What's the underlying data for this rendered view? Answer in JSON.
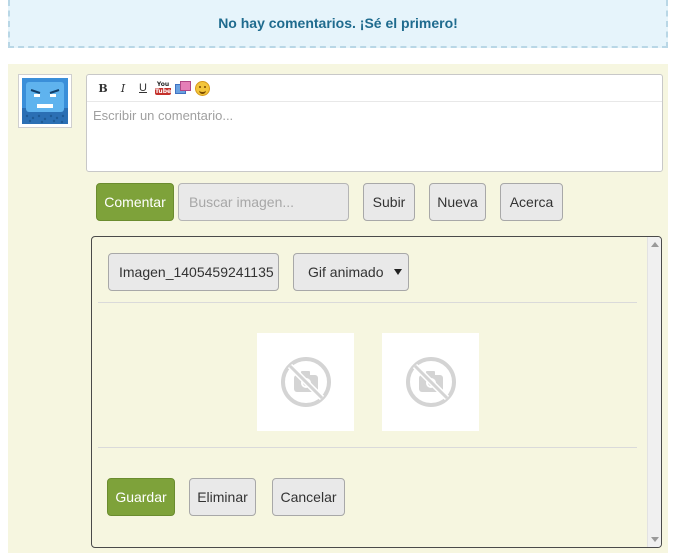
{
  "notice": {
    "text": "No hay comentarios. ¡Sé el primero!"
  },
  "editor": {
    "toolbar": [
      {
        "name": "bold-icon",
        "label": "B"
      },
      {
        "name": "italic-icon",
        "label": "I"
      },
      {
        "name": "underline-icon",
        "label": "U"
      },
      {
        "name": "youtube-icon"
      },
      {
        "name": "image-icon"
      },
      {
        "name": "emoji-icon"
      }
    ],
    "placeholder": "Escribir un comentario..."
  },
  "actions": {
    "comment_label": "Comentar",
    "search_placeholder": "Buscar imagen...",
    "upload_label": "Subir",
    "new_label": "Nueva",
    "about_label": "Acerca"
  },
  "image_panel": {
    "filename": "Imagen_1405459241135",
    "format_selected": "Gif animado",
    "thumbnails": [
      "broken-image-icon",
      "broken-image-icon"
    ],
    "save_label": "Guardar",
    "delete_label": "Eliminar",
    "cancel_label": "Cancelar"
  },
  "colors": {
    "accent_green": "#7ea23a",
    "panel_bg": "#f6f6e0",
    "notice_bg": "#e6f4fb",
    "notice_text": "#1f6b8e"
  }
}
